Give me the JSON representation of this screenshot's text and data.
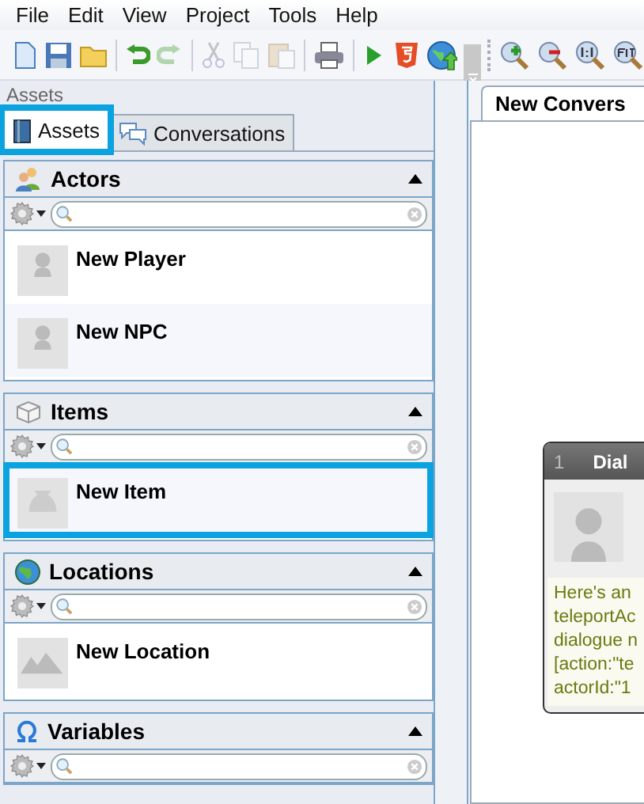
{
  "menu": [
    {
      "label": "File"
    },
    {
      "label": "Edit"
    },
    {
      "label": "View"
    },
    {
      "label": "Project"
    },
    {
      "label": "Tools"
    },
    {
      "label": "Help"
    }
  ],
  "toolbar": [
    {
      "kind": "new",
      "disabled": false
    },
    {
      "kind": "save",
      "disabled": false
    },
    {
      "kind": "open",
      "disabled": false
    },
    {
      "kind": "sep"
    },
    {
      "kind": "undo",
      "disabled": false
    },
    {
      "kind": "redo",
      "disabled": true
    },
    {
      "kind": "sep"
    },
    {
      "kind": "cut",
      "disabled": true
    },
    {
      "kind": "copy",
      "disabled": true
    },
    {
      "kind": "paste",
      "disabled": true
    },
    {
      "kind": "sep"
    },
    {
      "kind": "print",
      "disabled": false
    },
    {
      "kind": "sep"
    },
    {
      "kind": "play",
      "disabled": false
    },
    {
      "kind": "html5",
      "disabled": false
    },
    {
      "kind": "globe",
      "disabled": false
    },
    {
      "kind": "overflow"
    },
    {
      "kind": "zoomin",
      "disabled": false
    },
    {
      "kind": "zoomout",
      "disabled": false
    },
    {
      "kind": "zoom11",
      "disabled": false
    },
    {
      "kind": "zoomfit",
      "disabled": false
    }
  ],
  "panel_title": "Assets",
  "left_tabs": [
    {
      "label": "Assets",
      "selected": true,
      "highlighted": true
    },
    {
      "label": "Conversations",
      "selected": false,
      "highlighted": false
    }
  ],
  "sections": [
    {
      "title": "Actors",
      "kind": "actors",
      "expanded": true,
      "items": [
        {
          "name": "New Player",
          "kind": "actor",
          "highlighted": false
        },
        {
          "name": "New NPC",
          "kind": "actor",
          "highlighted": false
        }
      ]
    },
    {
      "title": "Items",
      "kind": "items",
      "expanded": true,
      "items": [
        {
          "name": "New Item",
          "kind": "item",
          "highlighted": true
        }
      ]
    },
    {
      "title": "Locations",
      "kind": "locations",
      "expanded": true,
      "items": [
        {
          "name": "New Location",
          "kind": "location",
          "highlighted": false
        }
      ]
    },
    {
      "title": "Variables",
      "kind": "variables",
      "expanded": true
    }
  ],
  "document_tabs": [
    {
      "label": "New Convers",
      "selected": true
    }
  ],
  "dialogue_node": {
    "number": "1",
    "title": "Dial",
    "lines": [
      "Here's an",
      "teleportAc",
      "dialogue n",
      "[action:\"te",
      "actorId:\"1"
    ]
  }
}
